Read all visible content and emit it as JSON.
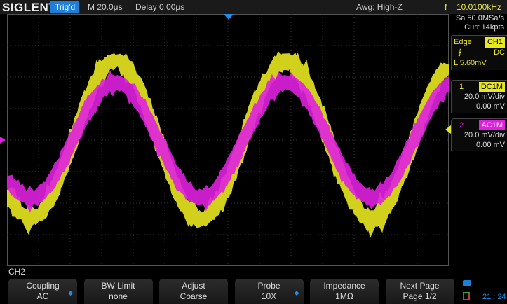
{
  "header": {
    "logo": "SIGLENT",
    "trig_status": "Trig'd",
    "timebase": "M 20.0μs",
    "delay": "Delay 0.00μs",
    "awg": "Awg: High-Z",
    "frequency": "f = 10.0100kHz"
  },
  "acquisition": {
    "sample_rate": "Sa 50.0MSa/s",
    "memory": "Curr 14kpts"
  },
  "trigger": {
    "type": "Edge",
    "source": "CH1",
    "slope_icon": "rising-edge-icon",
    "coupling": "DC",
    "level": "L  5.60mV"
  },
  "channels": [
    {
      "num": "1",
      "coupling": "DC1M",
      "scale": "20.0 mV/div",
      "offset": "0.00 mV",
      "color": "#e8e820"
    },
    {
      "num": "2",
      "coupling": "AC1M",
      "scale": "20.0 mV/div",
      "offset": "0.00 mV",
      "color": "#e020e0"
    }
  ],
  "menu": {
    "title": "CH2",
    "buttons": [
      {
        "label": "Coupling",
        "value": "AC",
        "arrow": true
      },
      {
        "label": "BW Limit",
        "value": "none",
        "arrow": false
      },
      {
        "label": "Adjust",
        "value": "Coarse",
        "arrow": false
      },
      {
        "label": "Probe",
        "value": "10X",
        "arrow": true
      },
      {
        "label": "Impedance",
        "value": "1MΩ",
        "arrow": false
      },
      {
        "label": "Next Page",
        "value": "Page 1/2",
        "arrow": false
      }
    ]
  },
  "status": {
    "time": "21 : 24",
    "usb_icon": "usb-icon",
    "network_icon": "network-icon"
  }
}
